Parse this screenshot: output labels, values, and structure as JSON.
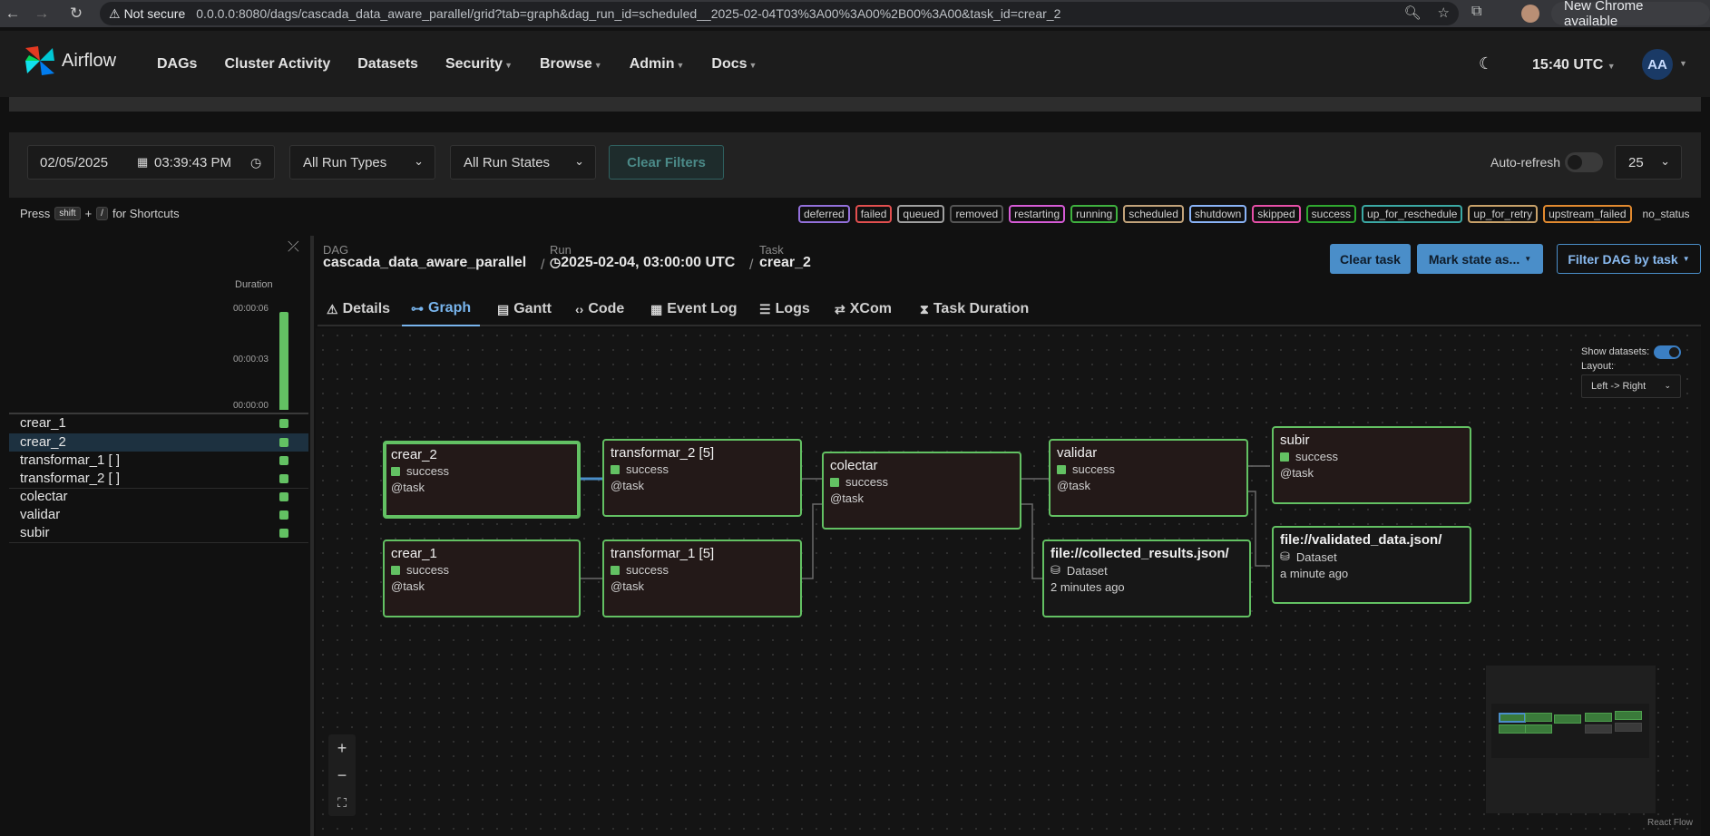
{
  "browser": {
    "not_secure": "Not secure",
    "url": "0.0.0.0:8080/dags/cascada_data_aware_parallel/grid?tab=graph&dag_run_id=scheduled__2025-02-04T03%3A00%3A00%2B00%3A00&task_id=crear_2",
    "new_chrome": "New Chrome available"
  },
  "navbar": {
    "brand": "Airflow",
    "items": [
      "DAGs",
      "Cluster Activity",
      "Datasets",
      "Security",
      "Browse",
      "Admin",
      "Docs"
    ],
    "time": "15:40 UTC",
    "avatar_initials": "AA"
  },
  "filters": {
    "date": "02/05/2025",
    "time": "03:39:43 PM",
    "run_types": "All Run Types",
    "run_states": "All Run States",
    "clear_filters": "Clear Filters",
    "auto_refresh": "Auto-refresh",
    "per_page": "25"
  },
  "shortcuts": {
    "press": "Press",
    "key1": "shift",
    "plus": "+",
    "key2": "/",
    "suffix": "for Shortcuts"
  },
  "legend": [
    {
      "label": "deferred",
      "color": "#9370db"
    },
    {
      "label": "failed",
      "color": "#e24f4f"
    },
    {
      "label": "queued",
      "color": "#a0a0a0"
    },
    {
      "label": "removed",
      "color": "#555555"
    },
    {
      "label": "restarting",
      "color": "#d65bd6"
    },
    {
      "label": "running",
      "color": "#3fb13f"
    },
    {
      "label": "scheduled",
      "color": "#c2a37a"
    },
    {
      "label": "shutdown",
      "color": "#8ab4f8"
    },
    {
      "label": "skipped",
      "color": "#e74fa8"
    },
    {
      "label": "success",
      "color": "#2fa82f"
    },
    {
      "label": "up_for_reschedule",
      "color": "#3ba9a4"
    },
    {
      "label": "up_for_retry",
      "color": "#c9a26a"
    },
    {
      "label": "upstream_failed",
      "color": "#e28a2f"
    },
    {
      "label": "no_status",
      "color": "transparent"
    }
  ],
  "grid": {
    "duration_label": "Duration",
    "ticks": [
      "00:00:06",
      "00:00:03",
      "00:00:00"
    ],
    "tasks": [
      "crear_1",
      "crear_2",
      "transformar_1 [ ]",
      "transformar_2 [ ]",
      "colectar",
      "validar",
      "subir"
    ]
  },
  "details": {
    "dag_label": "DAG",
    "dag": "cascada_data_aware_parallel",
    "run_label": "Run",
    "run": "2025-02-04, 03:00:00 UTC",
    "task_label": "Task",
    "task": "crear_2",
    "clear_task": "Clear task",
    "mark_state": "Mark state as...",
    "filter_dag": "Filter DAG by task"
  },
  "tabs": [
    "Details",
    "Graph",
    "Gantt",
    "Code",
    "Event Log",
    "Logs",
    "XCom",
    "Task Duration"
  ],
  "graph": {
    "show_datasets": "Show datasets:",
    "layout_label": "Layout:",
    "layout_value": "Left -> Right",
    "nodes": [
      {
        "name": "crear_2",
        "state": "success",
        "op": "@task"
      },
      {
        "name": "crear_1",
        "state": "success",
        "op": "@task"
      },
      {
        "name": "transformar_2 [5]",
        "state": "success",
        "op": "@task"
      },
      {
        "name": "transformar_1 [5]",
        "state": "success",
        "op": "@task"
      },
      {
        "name": "colectar",
        "state": "success",
        "op": "@task"
      },
      {
        "name": "validar",
        "state": "success",
        "op": "@task"
      },
      {
        "name": "subir",
        "state": "success",
        "op": "@task"
      }
    ],
    "datasets": [
      {
        "name": "file://collected_results.json/",
        "kind": "Dataset",
        "ago": "2 minutes ago"
      },
      {
        "name": "file://validated_data.json/",
        "kind": "Dataset",
        "ago": "a minute ago"
      }
    ],
    "attribution": "React Flow"
  }
}
